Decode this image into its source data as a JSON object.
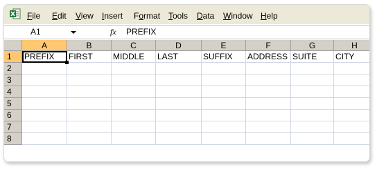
{
  "menu": {
    "items": [
      {
        "key": "file",
        "pre": "",
        "acc": "F",
        "post": "ile"
      },
      {
        "key": "edit",
        "pre": "",
        "acc": "E",
        "post": "dit"
      },
      {
        "key": "view",
        "pre": "",
        "acc": "V",
        "post": "iew"
      },
      {
        "key": "insert",
        "pre": "",
        "acc": "I",
        "post": "nsert"
      },
      {
        "key": "format",
        "pre": "F",
        "acc": "o",
        "post": "rmat"
      },
      {
        "key": "tools",
        "pre": "",
        "acc": "T",
        "post": "ools"
      },
      {
        "key": "data",
        "pre": "",
        "acc": "D",
        "post": "ata"
      },
      {
        "key": "window",
        "pre": "",
        "acc": "W",
        "post": "indow"
      },
      {
        "key": "help",
        "pre": "",
        "acc": "H",
        "post": "elp"
      }
    ]
  },
  "formula_bar": {
    "name_box": "A1",
    "fx_label": "fx",
    "value": "PREFIX"
  },
  "sheet": {
    "columns": [
      "A",
      "B",
      "C",
      "D",
      "E",
      "F",
      "G",
      "H"
    ],
    "rows": [
      "1",
      "2",
      "3",
      "4",
      "5",
      "6",
      "7",
      "8"
    ],
    "row1": [
      "PREFIX",
      "FIRST",
      "MIDDLE",
      "LAST",
      "SUFFIX",
      "ADDRESS",
      "SUITE",
      "CITY"
    ],
    "active_cell": "A1"
  },
  "colors": {
    "menubar_bg": "#ece9d8",
    "header_bg": "#d4d0c8",
    "active_header": "#ffc870",
    "gridline": "#d0d7e5",
    "excel_green": "#1f7a3a"
  }
}
